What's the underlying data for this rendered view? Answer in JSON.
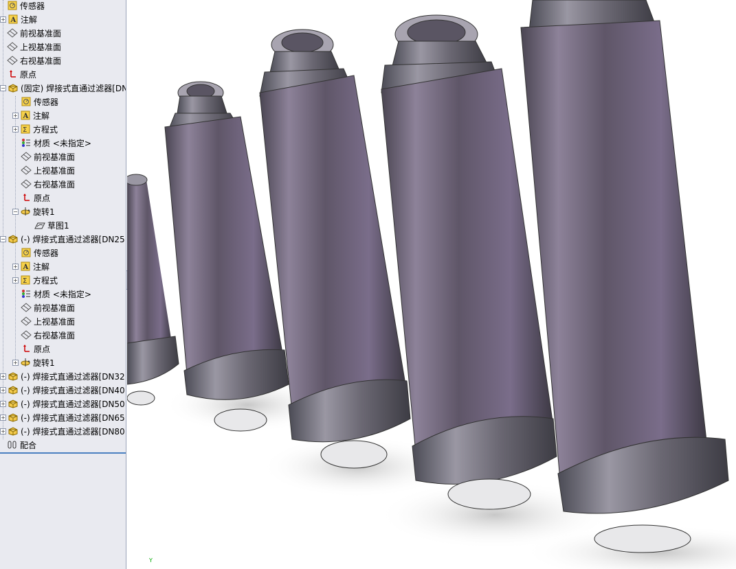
{
  "feature_tree": {
    "top_items": [
      {
        "label": "传感器",
        "icon": "sensor-icon"
      },
      {
        "label": "注解",
        "icon": "annotation-icon"
      },
      {
        "label": "前视基准面",
        "icon": "plane-icon"
      },
      {
        "label": "上视基准面",
        "icon": "plane-icon"
      },
      {
        "label": "右视基准面",
        "icon": "plane-icon"
      },
      {
        "label": "原点",
        "icon": "origin-icon"
      }
    ],
    "component1": {
      "label": "(固定) 焊接式直通过滤器[DN",
      "children": [
        {
          "label": "传感器",
          "icon": "sensor-icon"
        },
        {
          "label": "注解",
          "icon": "annotation-icon"
        },
        {
          "label": "方程式",
          "icon": "equation-icon"
        },
        {
          "label": "材质 <未指定>",
          "icon": "material-icon"
        },
        {
          "label": "前视基准面",
          "icon": "plane-icon"
        },
        {
          "label": "上视基准面",
          "icon": "plane-icon"
        },
        {
          "label": "右视基准面",
          "icon": "plane-icon"
        },
        {
          "label": "原点",
          "icon": "origin-icon"
        },
        {
          "label": "旋转1",
          "icon": "revolve-icon"
        }
      ],
      "sketch": "草图1"
    },
    "component2": {
      "label": "(-) 焊接式直通过滤器[DN25",
      "children": [
        {
          "label": "传感器",
          "icon": "sensor-icon"
        },
        {
          "label": "注解",
          "icon": "annotation-icon"
        },
        {
          "label": "方程式",
          "icon": "equation-icon"
        },
        {
          "label": "材质 <未指定>",
          "icon": "material-icon"
        },
        {
          "label": "前视基准面",
          "icon": "plane-icon"
        },
        {
          "label": "上视基准面",
          "icon": "plane-icon"
        },
        {
          "label": "右视基准面",
          "icon": "plane-icon"
        },
        {
          "label": "原点",
          "icon": "origin-icon"
        },
        {
          "label": "旋转1",
          "icon": "revolve-icon"
        }
      ]
    },
    "other_components": [
      "(-) 焊接式直通过滤器[DN32",
      "(-) 焊接式直通过滤器[DN40",
      "(-) 焊接式直通过滤器[DN50",
      "(-) 焊接式直通过滤器[DN65",
      "(-) 焊接式直通过滤器[DN80"
    ],
    "mates": "配合"
  },
  "viewport": {
    "triad_label": "Y",
    "body_color": "#6e6477",
    "highlight_color": "#b7adc2"
  }
}
